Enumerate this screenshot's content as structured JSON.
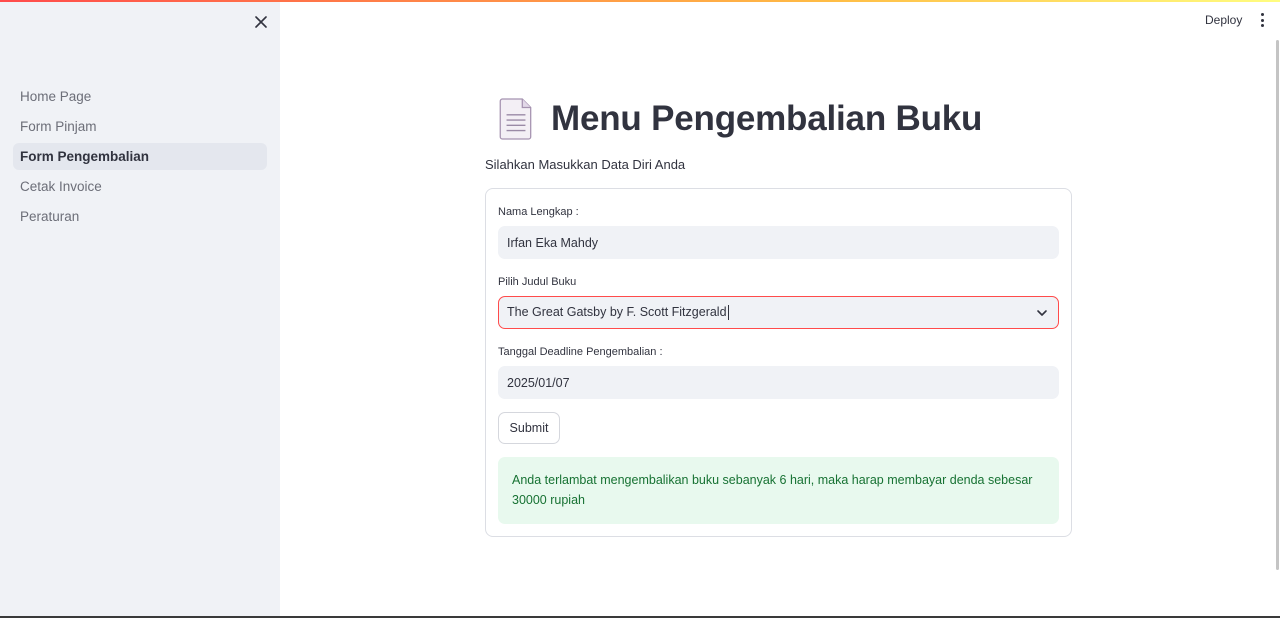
{
  "header": {
    "deploy_label": "Deploy"
  },
  "sidebar": {
    "items": [
      {
        "label": "Home Page"
      },
      {
        "label": "Form Pinjam"
      },
      {
        "label": "Form Pengembalian",
        "active": true
      },
      {
        "label": "Cetak Invoice"
      },
      {
        "label": "Peraturan"
      }
    ]
  },
  "main": {
    "title": "Menu Pengembalian Buku",
    "subtitle": "Silahkan Masukkan Data Diri Anda",
    "form": {
      "name_label": "Nama Lengkap :",
      "name_value": "Irfan Eka Mahdy",
      "book_label": "Pilih Judul Buku",
      "book_value": "The Great Gatsby by F. Scott Fitzgerald",
      "deadline_label": "Tanggal Deadline Pengembalian :",
      "deadline_value": "2025/01/07",
      "submit_label": "Submit",
      "alert_text": "Anda terlambat mengembalikan buku sebanyak 6 hari, maka harap membayar denda sebesar 30000 rupiah"
    }
  },
  "icons": {
    "close": "close-icon",
    "kebab": "kebab-menu-icon",
    "page": "document-icon",
    "chevron": "chevron-down-icon"
  },
  "colors": {
    "accent_red": "#ff4b4b",
    "success_text": "#177233",
    "success_bg": "#e8f9ee"
  }
}
